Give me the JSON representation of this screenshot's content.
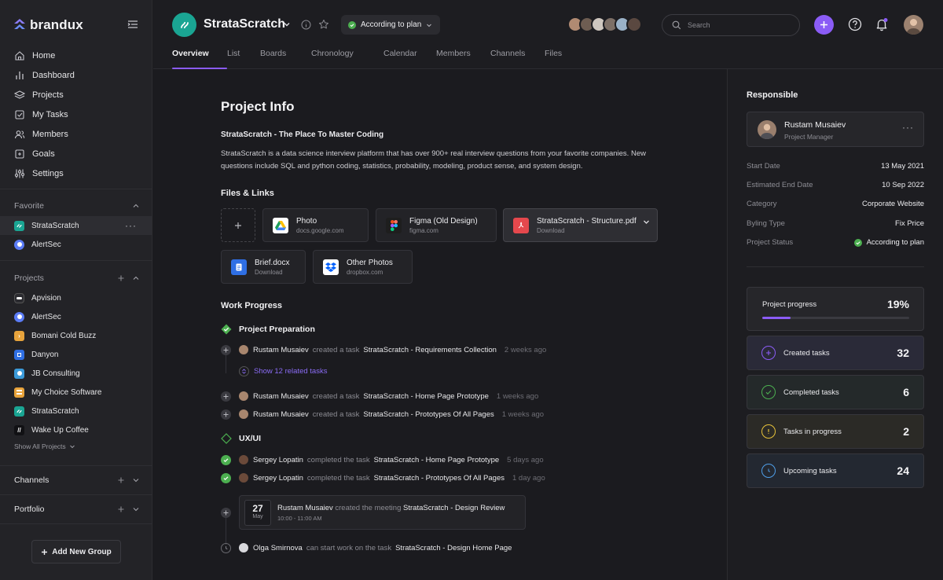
{
  "brand": {
    "name": "brandux"
  },
  "nav": [
    {
      "label": "Home",
      "icon": "home-icon"
    },
    {
      "label": "Dashboard",
      "icon": "dashboard-icon"
    },
    {
      "label": "Projects",
      "icon": "projects-icon"
    },
    {
      "label": "My Tasks",
      "icon": "tasks-icon"
    },
    {
      "label": "Members",
      "icon": "members-icon"
    },
    {
      "label": "Goals",
      "icon": "goals-icon"
    },
    {
      "label": "Settings",
      "icon": "settings-icon"
    }
  ],
  "favorite": {
    "label": "Favorite",
    "items": [
      {
        "label": "StrataScratch",
        "color": "#1aa593"
      },
      {
        "label": "AlertSec",
        "color": "#5b7cf6"
      }
    ]
  },
  "projects": {
    "label": "Projects",
    "items": [
      {
        "label": "Apvision",
        "color": "#2b2b30"
      },
      {
        "label": "AlertSec",
        "color": "#5b7cf6"
      },
      {
        "label": "Bomani Cold Buzz",
        "color": "#e7a33c"
      },
      {
        "label": "Danyon",
        "color": "#2f6fe4"
      },
      {
        "label": "JB Consulting",
        "color": "#3b9ad9"
      },
      {
        "label": "My Choice Software",
        "color": "#e8a33b"
      },
      {
        "label": "StrataScratch",
        "color": "#1aa593"
      },
      {
        "label": "Wake Up Coffee",
        "color": "#111114"
      }
    ],
    "show_all": "Show All Projects"
  },
  "channels": {
    "label": "Channels"
  },
  "portfolio": {
    "label": "Portfolio"
  },
  "add_group": "Add New Group",
  "header": {
    "project_name": "StrataScratch",
    "status": "According to plan",
    "search_placeholder": "Search",
    "tabs": [
      "Overview",
      "List",
      "Boards",
      "Chronology",
      "Calendar",
      "Members",
      "Channels",
      "Files"
    ],
    "active_tab": "Overview"
  },
  "main": {
    "title": "Project Info",
    "subtitle": "StrataScratch - The Place To Master Coding",
    "description": "StrataScratch is a data science interview platform that has over 900+ real interview questions from your favorite companies. New questions include SQL and python coding, statistics, probability, modeling, product sense, and system design.",
    "files_title": "Files & Links",
    "files": [
      {
        "name": "Photo",
        "source": "docs.google.com",
        "icon": "google-drive-icon"
      },
      {
        "name": "Figma (Old Design)",
        "source": "figma.com",
        "icon": "figma-icon"
      },
      {
        "name": "StrataScratch - Structure.pdf",
        "source": "Download",
        "icon": "pdf-icon"
      },
      {
        "name": "Brief.docx",
        "source": "Download",
        "icon": "doc-icon"
      },
      {
        "name": "Other Photos",
        "source": "dropbox.com",
        "icon": "dropbox-icon"
      }
    ],
    "work_title": "Work Progress",
    "groups": [
      {
        "name": "Project Preparation"
      },
      {
        "name": "UX/UI"
      }
    ],
    "activities": [
      {
        "who": "Rustam Musaiev",
        "action": "created a task",
        "task": "StrataScratch - Requirements Collection",
        "when": "2 weeks ago"
      },
      {
        "who": "Rustam Musaiev",
        "action": "created a task",
        "task": "StrataScratch - Home Page Prototype",
        "when": "1 weeks ago"
      },
      {
        "who": "Rustam Musaiev",
        "action": "created a task",
        "task": "StrataScratch - Prototypes Of All Pages",
        "when": "1 weeks ago"
      },
      {
        "who": "Sergey Lopatin",
        "action": "completed the task",
        "task": "StrataScratch - Home Page Prototype",
        "when": "5 days ago"
      },
      {
        "who": "Sergey Lopatin",
        "action": "completed the task",
        "task": "StrataScratch - Prototypes Of All Pages",
        "when": "1 day ago"
      },
      {
        "who": "Olga Smirnova",
        "action": "can start work on the task",
        "task": "StrataScratch - Design Home Page",
        "when": ""
      }
    ],
    "related": "Show 12 related tasks",
    "meeting": {
      "day": "27",
      "month": "May",
      "who": "Rustam Musaiev",
      "action": "created the meeting",
      "title": "StrataScratch - Design Review",
      "time": "10:00 - 11:00 AM"
    }
  },
  "right": {
    "responsible_title": "Responsible",
    "person": {
      "name": "Rustam Musaiev",
      "role": "Project Manager"
    },
    "details": [
      {
        "key": "Start Date",
        "value": "13 May 2021"
      },
      {
        "key": "Estimated End Date",
        "value": "10 Sep 2022"
      },
      {
        "key": "Category",
        "value": "Corporate Website"
      },
      {
        "key": "Byling Type",
        "value": "Fix Price"
      },
      {
        "key": "Project Status",
        "value": "According to plan"
      }
    ],
    "progress": {
      "label": "Project progress",
      "value": "19%",
      "fraction": 0.19
    },
    "stats": [
      {
        "label": "Created tasks",
        "value": "32",
        "color": "#8b5cf6"
      },
      {
        "label": "Completed tasks",
        "value": "6",
        "color": "#4caf50"
      },
      {
        "label": "Tasks in progress",
        "value": "2",
        "color": "#e6c23a"
      },
      {
        "label": "Upcoming tasks",
        "value": "24",
        "color": "#4f9ee8"
      }
    ]
  }
}
